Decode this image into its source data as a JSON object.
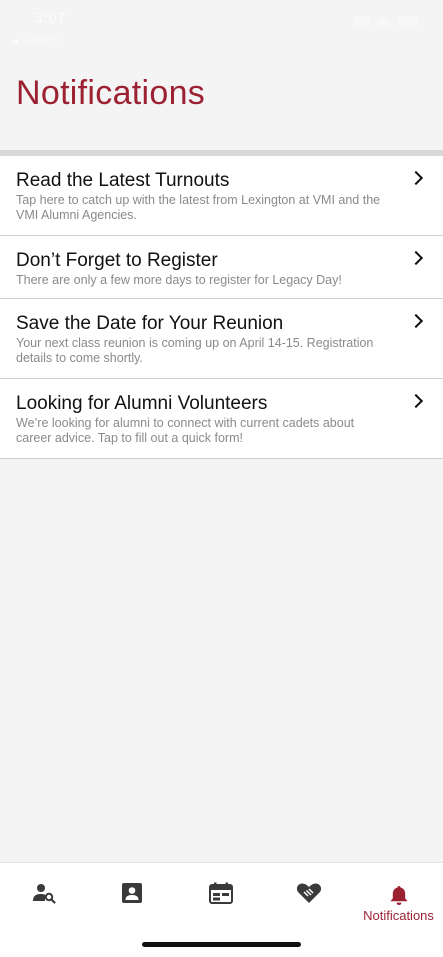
{
  "status_bar": {
    "time": "3:07",
    "back_label": "◂ Search"
  },
  "page": {
    "title": "Notifications"
  },
  "notifications": [
    {
      "title": "Read the Latest Turnouts",
      "body": "Tap here to catch up with the latest from Lexington at VMI and the VMI Alumni Agencies."
    },
    {
      "title": "Don’t Forget to Register",
      "body": "There are only a few more days to register for Legacy Day!"
    },
    {
      "title": "Save the Date for Your Reunion",
      "body": "Your next class reunion is coming up on April 14-15. Registration details to come shortly."
    },
    {
      "title": "Looking for Alumni Volunteers",
      "body": "We’re looking for alumni to connect with current cadets about career advice. Tap to fill out a quick form!"
    }
  ],
  "tab_bar": {
    "tabs": [
      {
        "icon": "person-search-icon",
        "label": ""
      },
      {
        "icon": "contact-card-icon",
        "label": ""
      },
      {
        "icon": "calendar-icon",
        "label": ""
      },
      {
        "icon": "heart-handshake-icon",
        "label": ""
      },
      {
        "icon": "bell-icon",
        "label": "Notifications",
        "active": true
      }
    ]
  },
  "colors": {
    "accent": "#9c2233",
    "icon": "#3a3a3a",
    "background": "#f4f4f4"
  }
}
